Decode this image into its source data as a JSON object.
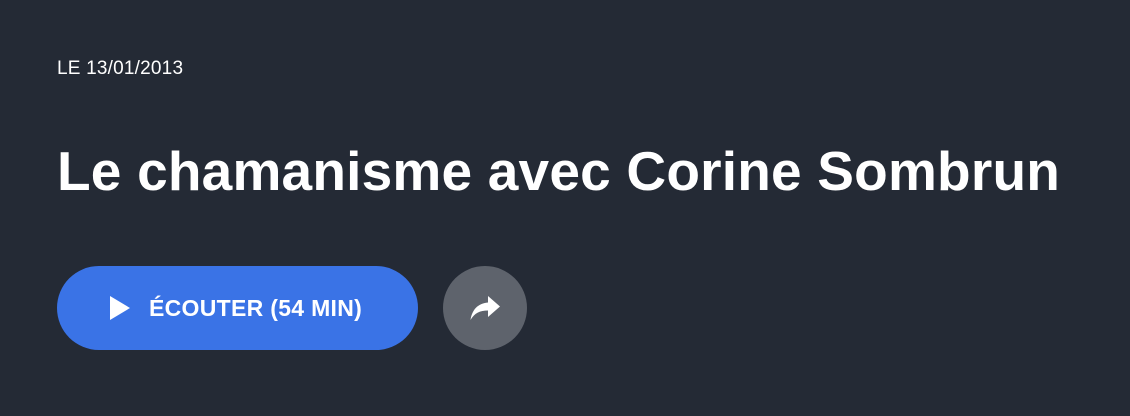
{
  "episode": {
    "date": "LE 13/01/2013",
    "title": "Le chamanisme avec Corine Sombrun"
  },
  "actions": {
    "listen_label": "ÉCOUTER (54 MIN)",
    "listen_icon": "play-icon",
    "share_icon": "share-icon"
  },
  "colors": {
    "background": "#242a35",
    "primary_button": "#3a73e6",
    "secondary_button": "#5e636c",
    "text": "#ffffff"
  }
}
